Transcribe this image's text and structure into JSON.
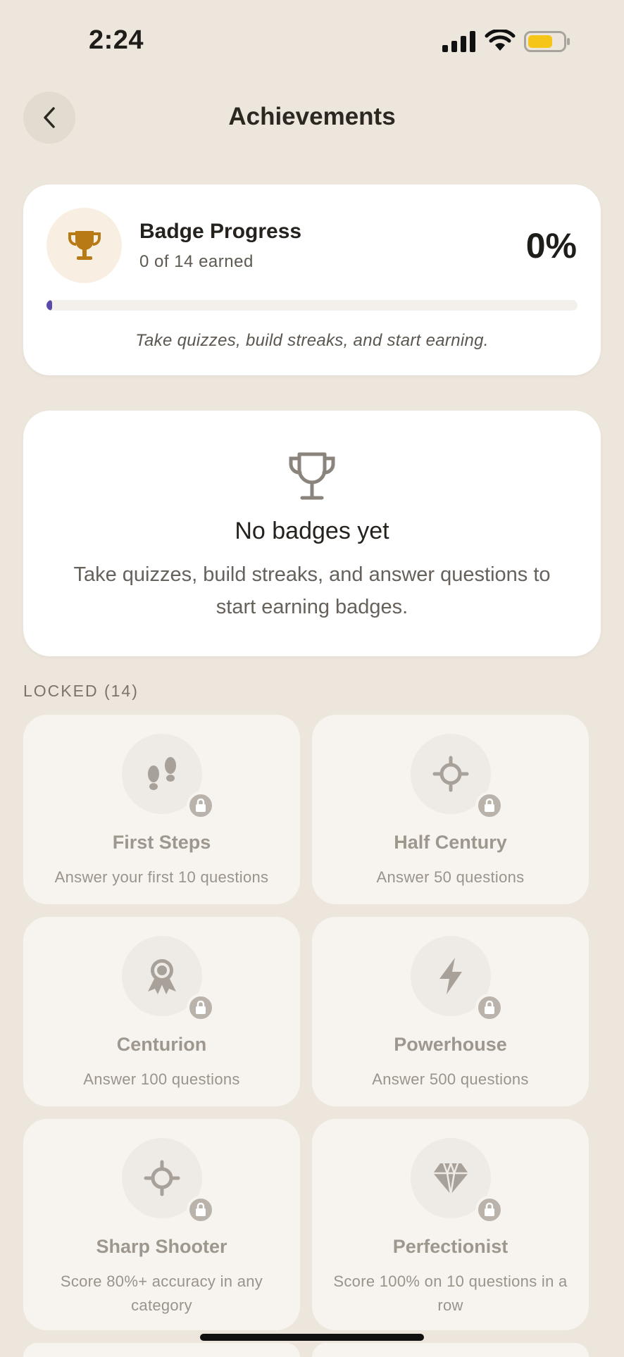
{
  "status_bar": {
    "time": "2:24",
    "battery_color": "#f5c518"
  },
  "header": {
    "title": "Achievements"
  },
  "progress": {
    "title": "Badge Progress",
    "subtitle": "0 of 14 earned",
    "percent_label": "0%",
    "percent_value": 0,
    "hint": "Take quizzes, build streaks, and start earning.",
    "accent_color": "#5a4ba8",
    "trophy_color": "#b87a15"
  },
  "empty_state": {
    "title": "No badges yet",
    "description": "Take quizzes, build streaks, and answer questions to start earning badges."
  },
  "locked_section": {
    "label": "LOCKED (14)"
  },
  "badges": [
    {
      "name": "First Steps",
      "description": "Answer your first 10 questions",
      "icon": "footprints-icon"
    },
    {
      "name": "Half Century",
      "description": "Answer 50 questions",
      "icon": "crosshair-icon"
    },
    {
      "name": "Centurion",
      "description": "Answer 100 questions",
      "icon": "award-ribbon-icon"
    },
    {
      "name": "Powerhouse",
      "description": "Answer 500 questions",
      "icon": "lightning-icon"
    },
    {
      "name": "Sharp Shooter",
      "description": "Score 80%+ accuracy in any category",
      "icon": "crosshair-icon"
    },
    {
      "name": "Perfectionist",
      "description": "Score 100% on 10 questions in a row",
      "icon": "diamond-icon"
    }
  ]
}
